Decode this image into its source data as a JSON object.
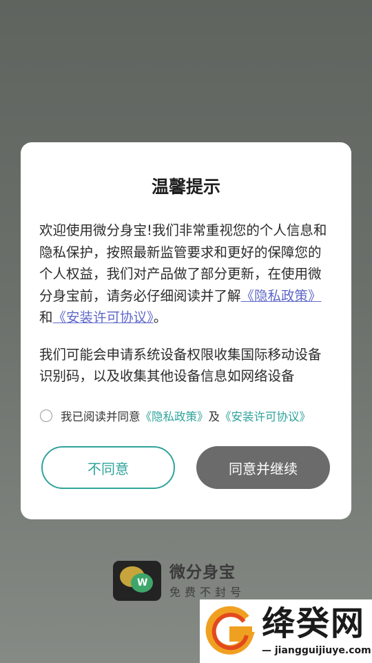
{
  "dialog": {
    "title": "温馨提示",
    "paragraph1_text": "欢迎使用微分身宝!我们非常重视您的个人信息和隐私保护，按照最新监管要求和更好的保障您的个人权益，我们对产品做了部分更新，在使用微分身宝前，请务必仔细阅读并了解",
    "privacy_link": "《隐私政策》",
    "and_text": "和",
    "license_link": "《安装许可协议》",
    "period": "。",
    "paragraph2_text": "我们可能会申请系统设备权限收集国际移动设备识别码，以及收集其他设备信息如网络设备",
    "agree_label": "我已阅读并同意",
    "agree_privacy_link": "《隐私政策》",
    "agree_and": "及",
    "agree_license_link": "《安装许可协议》",
    "disagree_button": "不同意",
    "agree_button": "同意并继续"
  },
  "brand": {
    "icon_letter": "W",
    "name": "微分身宝",
    "tagline": "免费不封号"
  },
  "watermark": {
    "title": "绛癸网",
    "url": "jiangguijiuye.com"
  },
  "colors": {
    "accent_green": "#2fa39b",
    "link_blue": "#5f68c8",
    "agree_button_bg": "#6b6b6b"
  }
}
